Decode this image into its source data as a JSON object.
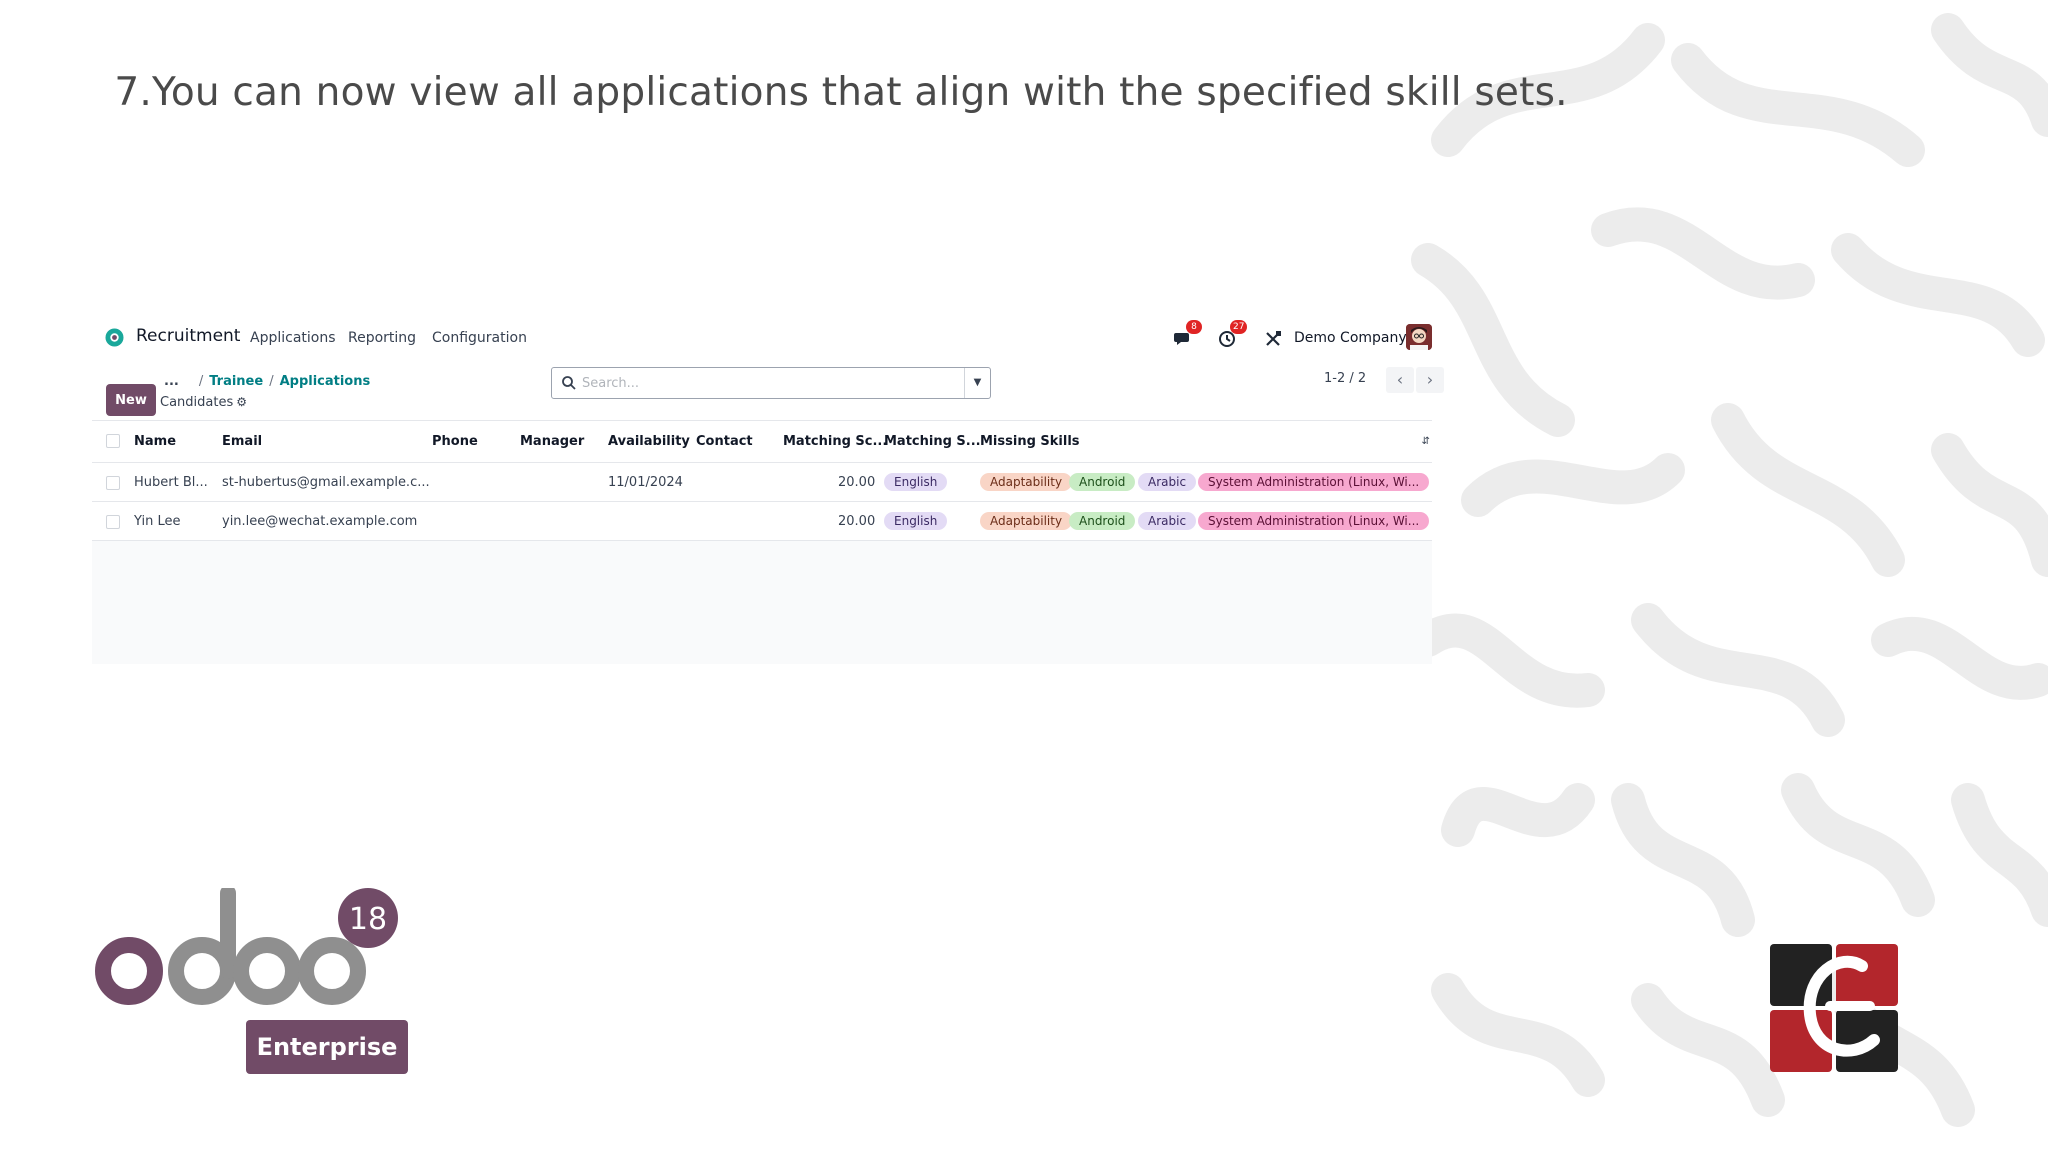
{
  "slide": {
    "step_number": "7.",
    "instruction": "You can now view all applications that align with the specified skill sets."
  },
  "navbar": {
    "app_name": "Recruitment",
    "menu": [
      "Applications",
      "Reporting",
      "Configuration"
    ],
    "chat_badge": "8",
    "activity_badge": "27",
    "company": "Demo Company"
  },
  "control_panel": {
    "new_label": "New",
    "breadcrumb": {
      "ellipsis": "...",
      "items": [
        "Trainee",
        "Applications"
      ]
    },
    "subtitle": "Candidates",
    "search_placeholder": "Search...",
    "pager": "1-2 / 2"
  },
  "table": {
    "columns": [
      "Name",
      "Email",
      "Phone",
      "Manager",
      "Availability",
      "Contact",
      "Matching Sc...",
      "Matching S...",
      "Missing Skills"
    ],
    "rows": [
      {
        "name": "Hubert Bl...",
        "email": "st-hubertus@gmail.example.c...",
        "phone": "",
        "manager": "",
        "availability": "11/01/2024",
        "contact": "",
        "matching_score": "20.00",
        "matching_skills": [
          "English"
        ],
        "missing_skills": [
          "Adaptability",
          "Android",
          "Arabic",
          "System Administration (Linux, Wi..."
        ]
      },
      {
        "name": "Yin Lee",
        "email": "yin.lee@wechat.example.com",
        "phone": "",
        "manager": "",
        "availability": "",
        "contact": "",
        "matching_score": "20.00",
        "matching_skills": [
          "English"
        ],
        "missing_skills": [
          "Adaptability",
          "Android",
          "Arabic",
          "System Administration (Linux, Wi..."
        ]
      }
    ]
  },
  "branding": {
    "odoo_version": "18",
    "edition": "Enterprise"
  },
  "colors": {
    "brand_primary": "#714b67",
    "link": "#017e84",
    "tag_english": "#e3dbf5",
    "tag_adaptability": "#f9d5c6",
    "tag_android": "#c8ecc4",
    "tag_arabic": "#e3dbf5",
    "tag_system_admin": "#f7a8cf"
  }
}
